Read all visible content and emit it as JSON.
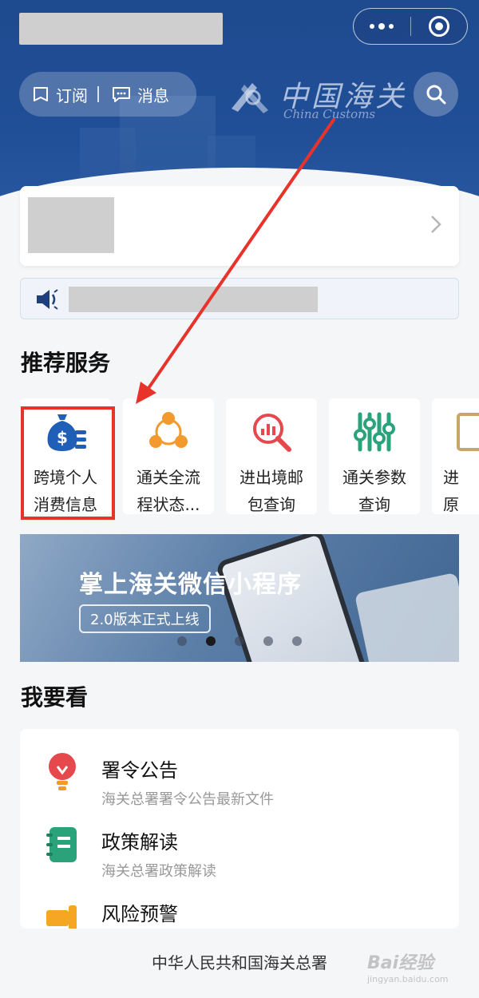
{
  "header": {
    "subscribe_label": "订阅",
    "divider": "|",
    "message_label": "消息",
    "logo_text": "中国海关",
    "logo_subtext": "China Customs"
  },
  "colors": {
    "brand_blue": "#214f97",
    "highlight_red": "#e8332b",
    "icon_blue": "#1f5fb8",
    "icon_orange": "#f29a2e",
    "icon_red": "#e5484d",
    "icon_green": "#2aa37a"
  },
  "recommended": {
    "heading": "推荐服务",
    "items": [
      {
        "line1": "跨境个人",
        "line2": "消费信息",
        "icon": "money-bag-icon",
        "highlighted": true
      },
      {
        "line1": "通关全流",
        "line2": "程状态...",
        "icon": "share-nodes-icon",
        "highlighted": false
      },
      {
        "line1": "进出境邮",
        "line2": "包查询",
        "icon": "chart-search-icon",
        "highlighted": false
      },
      {
        "line1": "通关参数",
        "line2": "查询",
        "icon": "sliders-icon",
        "highlighted": false
      },
      {
        "line1": "进",
        "line2": "原",
        "icon": "document-icon",
        "highlighted": false
      }
    ]
  },
  "banner": {
    "title": "掌上海关微信小程序",
    "tag": "2.0版本正式上线",
    "dot_count": 5,
    "active_dot": 1
  },
  "watch": {
    "heading": "我要看",
    "items": [
      {
        "title": "署令公告",
        "subtitle": "海关总署署令公告最新文件",
        "icon": "lightbulb-icon"
      },
      {
        "title": "政策解读",
        "subtitle": "海关总署政策解读",
        "icon": "notebook-icon"
      },
      {
        "title": "风险预警",
        "subtitle": "",
        "icon": "alert-horn-icon"
      }
    ]
  },
  "footer": {
    "text": "中华人民共和国海关总署",
    "watermark": "Bai经验",
    "watermark_sub": "jingyan.baidu.com"
  }
}
